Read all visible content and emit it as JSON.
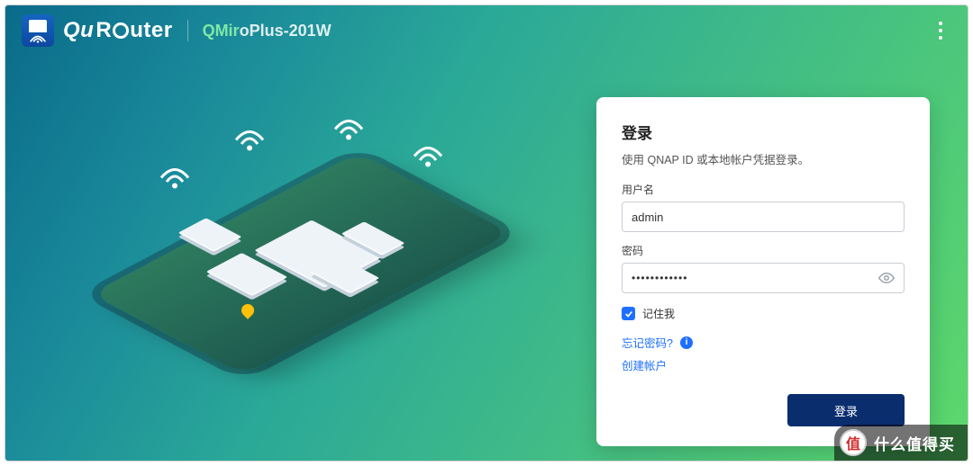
{
  "header": {
    "brand": "QuRouter",
    "model_prefix": "QMir",
    "model_suffix": "oPlus-201W"
  },
  "login": {
    "title": "登录",
    "subtitle": "使用 QNAP ID 或本地帐户凭据登录。",
    "username_label": "用户名",
    "username_value": "admin",
    "password_label": "密码",
    "password_value": "••••••••••••",
    "remember_label": "记住我",
    "remember_checked": true,
    "forgot_link": "忘记密码?",
    "create_link": "创建帐户",
    "submit_label": "登录"
  },
  "footer": {
    "badge_char": "值",
    "badge_text": "什么值得买"
  },
  "colors": {
    "primary_blue": "#1e6fff",
    "button_navy": "#0a2d6e",
    "accent_green": "#7fe8a8"
  }
}
